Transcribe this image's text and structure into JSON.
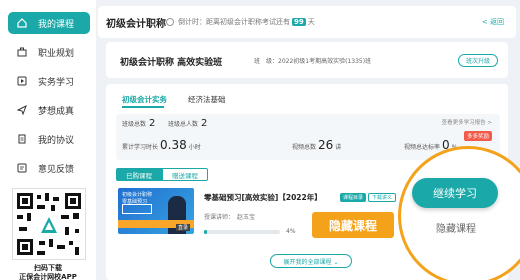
{
  "colors": {
    "accent": "#1aa8a8",
    "highlight": "#f5a21b",
    "badge_red": "#f25a4b"
  },
  "sidebar": {
    "items": [
      {
        "label": "我的课程",
        "icon": "home-icon",
        "active": true
      },
      {
        "label": "职业规划",
        "icon": "briefcase-icon",
        "active": false
      },
      {
        "label": "实务学习",
        "icon": "play-icon",
        "active": false
      },
      {
        "label": "梦想成真",
        "icon": "send-icon",
        "active": false
      },
      {
        "label": "我的协议",
        "icon": "document-icon",
        "active": false
      },
      {
        "label": "意见反馈",
        "icon": "feedback-icon",
        "active": false
      }
    ],
    "qr_caption_line1": "扫码下载",
    "qr_caption_line2": "正保会计网校APP"
  },
  "header": {
    "title": "初级会计职称",
    "countdown_prefix": "倒计时：距离初级会计职称考试还有",
    "countdown_days": "99",
    "countdown_suffix": "天",
    "back_label": "< 返回"
  },
  "course": {
    "title": "初级会计职称 高效实验班",
    "class_label": "班　级：2022初级1考期高效实验(1335)班",
    "upgrade_label": "班次升级"
  },
  "main": {
    "tabs": [
      {
        "label": "初级会计实务",
        "active": true
      },
      {
        "label": "经济法基础",
        "active": false
      }
    ],
    "stats": {
      "class_total_label": "班级总数",
      "class_total_value": "2",
      "class_count_label": "班级总人数",
      "class_count_value": "2",
      "study_time_label": "累计学习时长",
      "study_time_value": "0.38",
      "study_time_unit": "小时",
      "lecture_total_label": "视频总数",
      "lecture_total_value": "26",
      "lecture_total_unit": "讲",
      "rate_label": "视频总达标率",
      "rate_value": "0",
      "rate_unit": "%",
      "study_record_link": "查看更多学习报告 >",
      "reward_badge": "多多奖励"
    },
    "segments": {
      "purchased": "已购课程",
      "gifted": "赠送课程"
    },
    "course_item": {
      "title": "零基础预习[高效实验]【2022年】",
      "badge_directory": "课程目录",
      "badge_download": "下载讲义",
      "teacher": "授课讲师：　赵玉宝",
      "progress": 4,
      "progress_text": "4%",
      "thumb_line1": "初级会计职称",
      "thumb_line2": "零基础预习",
      "thumb_tag": "直录"
    },
    "hide_banner": "隐藏课程",
    "expand_label": "展开我的全部课程 ⌄"
  },
  "overlay": {
    "continue_label": "继续学习",
    "hide_label": "隐藏课程"
  }
}
